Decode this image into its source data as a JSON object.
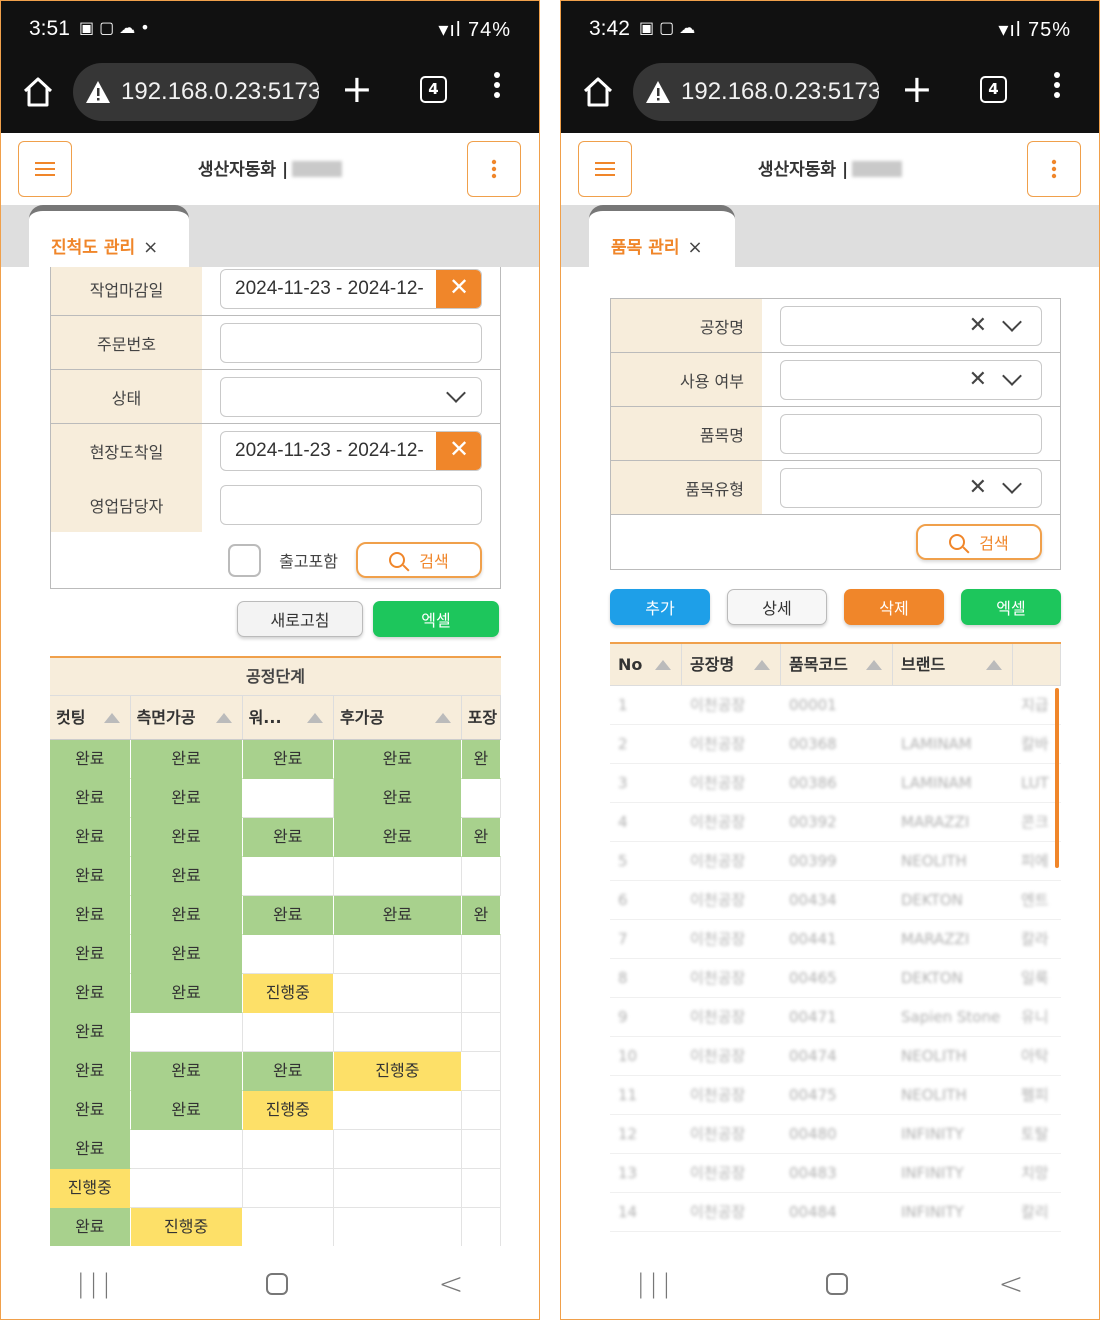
{
  "left": {
    "status": {
      "time": "3:51",
      "battery": "74%",
      "dot": "•"
    },
    "browser": {
      "url": "192.168.0.23:5173/",
      "tab_count": "4"
    },
    "app": {
      "title": "생산자동화 |"
    },
    "tab": {
      "label": "진척도 관리",
      "close": "×"
    },
    "form": {
      "work_deadline_label": "작업마감일",
      "work_deadline_value": "2024-11-23 - 2024-12-",
      "order_no_label": "주문번호",
      "status_label": "상태",
      "site_arrival_label": "현장도착일",
      "site_arrival_value": "2024-11-23 - 2024-12-",
      "sales_manager_label": "영업담당자",
      "include_shipped_label": "출고포함",
      "search_label": "검색"
    },
    "buttons": {
      "refresh": "새로고침",
      "excel": "엑셀"
    },
    "grid": {
      "group_header": "공정단계",
      "columns": [
        "컷팅",
        "측면가공",
        "워...",
        "후가공",
        "포장"
      ],
      "rows": [
        [
          "완료",
          "완료",
          "완료",
          "완료",
          "완"
        ],
        [
          "완료",
          "완료",
          "",
          "완료",
          ""
        ],
        [
          "완료",
          "완료",
          "완료",
          "완료",
          "완"
        ],
        [
          "완료",
          "완료",
          "",
          "",
          ""
        ],
        [
          "완료",
          "완료",
          "완료",
          "완료",
          "완"
        ],
        [
          "완료",
          "완료",
          "",
          "",
          ""
        ],
        [
          "완료",
          "완료",
          "진행중",
          "",
          ""
        ],
        [
          "완료",
          "",
          "",
          "",
          ""
        ],
        [
          "완료",
          "완료",
          "완료",
          "진행중",
          ""
        ],
        [
          "완료",
          "완료",
          "진행중",
          "",
          ""
        ],
        [
          "완료",
          "",
          "",
          "",
          ""
        ],
        [
          "진행중",
          "",
          "",
          "",
          ""
        ],
        [
          "완료",
          "진행중",
          "",
          "",
          ""
        ]
      ]
    }
  },
  "right": {
    "status": {
      "time": "3:42",
      "battery": "75%"
    },
    "browser": {
      "url": "192.168.0.23:5173/",
      "tab_count": "4"
    },
    "app": {
      "title": "생산자동화 |"
    },
    "tab": {
      "label": "품목 관리",
      "close": "×"
    },
    "form": {
      "factory_label": "공장명",
      "use_label": "사용 여부",
      "item_name_label": "품목명",
      "item_type_label": "품목유형",
      "search_label": "검색"
    },
    "buttons": {
      "add": "추가",
      "detail": "상세",
      "delete": "삭제",
      "excel": "엑셀"
    },
    "grid": {
      "columns": [
        "No",
        "공장명",
        "품목코드",
        "브랜드"
      ],
      "rows": [
        [
          "1",
          "이천공장",
          "00001",
          "",
          "지급"
        ],
        [
          "2",
          "이천공장",
          "00368",
          "LAMINAM",
          "칼바"
        ],
        [
          "3",
          "이천공장",
          "00386",
          "LAMINAM",
          "LUT"
        ],
        [
          "4",
          "이천공장",
          "00392",
          "MARAZZI",
          "콘크"
        ],
        [
          "5",
          "이천공장",
          "00399",
          "NEOLITH",
          "피에"
        ],
        [
          "6",
          "이천공장",
          "00434",
          "DEKTON",
          "엔트"
        ],
        [
          "7",
          "이천공장",
          "00441",
          "MARAZZI",
          "칼라"
        ],
        [
          "8",
          "이천공장",
          "00465",
          "DEKTON",
          "일룩"
        ],
        [
          "9",
          "이천공장",
          "00471",
          "Sapien Stone",
          "유니"
        ],
        [
          "10",
          "이천공장",
          "00474",
          "NEOLITH",
          "아탁"
        ],
        [
          "11",
          "이천공장",
          "00475",
          "NEOLITH",
          "펠피"
        ],
        [
          "12",
          "이천공장",
          "00480",
          "INFINITY",
          "토탈"
        ],
        [
          "13",
          "이천공장",
          "00483",
          "INFINITY",
          "치망"
        ],
        [
          "14",
          "이천공장",
          "00484",
          "INFINITY",
          "칼리"
        ]
      ]
    }
  }
}
